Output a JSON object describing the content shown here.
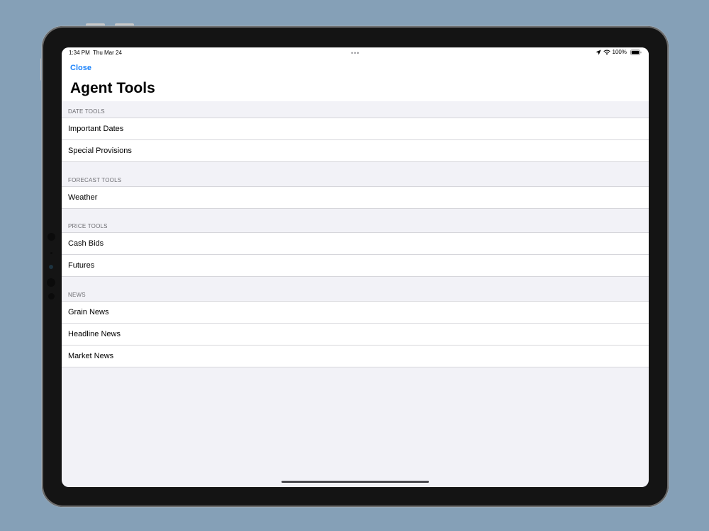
{
  "status_bar": {
    "time": "1:34 PM",
    "date": "Thu Mar 24",
    "multitask": "•••",
    "battery": "100%"
  },
  "nav": {
    "close_label": "Close",
    "title": "Agent Tools"
  },
  "sections": {
    "date_tools": {
      "header": "DATE TOOLS",
      "items": [
        "Important Dates",
        "Special Provisions"
      ]
    },
    "forecast_tools": {
      "header": "FORECAST TOOLS",
      "items": [
        "Weather"
      ]
    },
    "price_tools": {
      "header": "PRICE TOOLS",
      "items": [
        "Cash Bids",
        "Futures"
      ]
    },
    "news": {
      "header": "NEWS",
      "items": [
        "Grain News",
        "Headline News",
        "Market News"
      ]
    }
  },
  "colors": {
    "accent": "#1a82fb",
    "background": "#85a0b7",
    "grouped_background": "#f2f2f7",
    "section_header": "#6d6d72"
  },
  "icons": [
    "location-arrow-icon",
    "wifi-icon",
    "battery-icon"
  ]
}
